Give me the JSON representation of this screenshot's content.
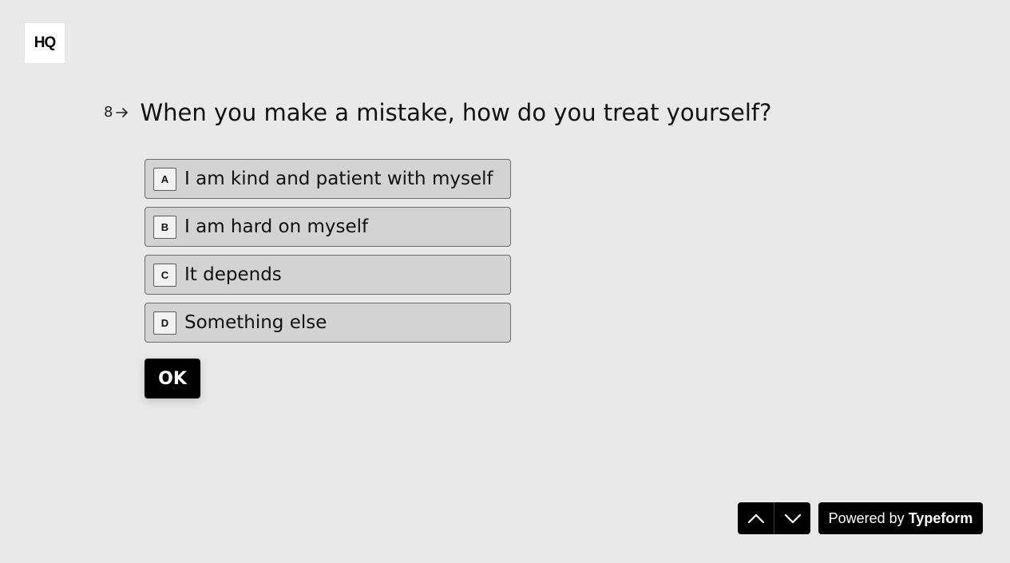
{
  "logo": {
    "text": "HQ"
  },
  "question": {
    "number": "8",
    "text": "When you make a mistake, how do you treat yourself?"
  },
  "options": [
    {
      "key": "A",
      "label": "I am kind and patient with myself"
    },
    {
      "key": "B",
      "label": "I am hard on myself"
    },
    {
      "key": "C",
      "label": "It depends"
    },
    {
      "key": "D",
      "label": "Something else"
    }
  ],
  "ok_button": {
    "label": "OK"
  },
  "footer": {
    "powered_prefix": "Powered by",
    "powered_brand": "Typeform",
    "nav_up_icon": "chevron-up-icon",
    "nav_down_icon": "chevron-down-icon"
  },
  "colors": {
    "background": "#e9e9e9",
    "option_background": "#d3d3d3",
    "button": "#000000",
    "button_text": "#ffffff"
  }
}
